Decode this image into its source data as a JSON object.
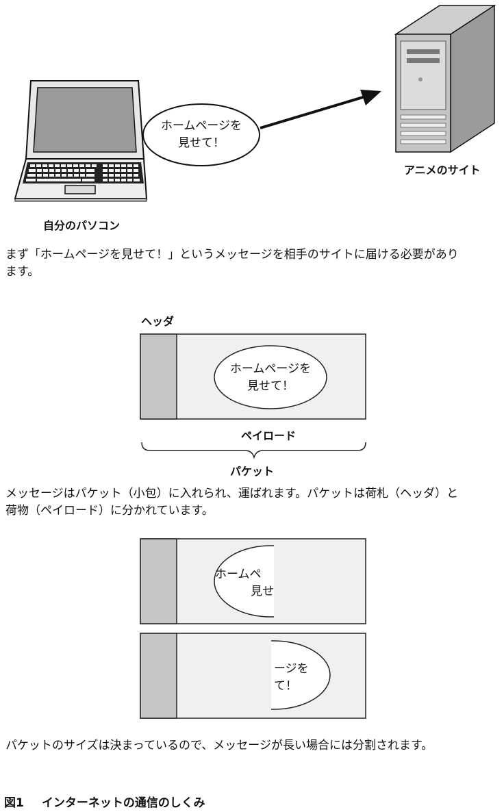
{
  "top_diagram": {
    "client_label": "自分のパソコン",
    "server_label": "アニメのサイト",
    "message_line1": "ホームページを",
    "message_line2": "見せて！"
  },
  "text1_line1": "まず「ホームページを見せて！」というメッセージを相手のサイトに届ける必要があり",
  "text1_line2": "ます。",
  "packet_diagram": {
    "header_label": "ヘッダ",
    "payload_label": "ペイロード",
    "packet_label": "パケット",
    "message_line1": "ホームページを",
    "message_line2": "見せて！"
  },
  "text2_line1": "メッセージはパケット（小包）に入れられ、運ばれます。パケットは荷札（ヘッダ）と",
  "text2_line2": "荷物（ペイロード）に分かれています。",
  "split_diagram": {
    "part1_line1": "ホームペ",
    "part1_line2": "見せ",
    "part2_line1": "ージを",
    "part2_line2": "て！"
  },
  "text3": "パケットのサイズは決まっているので、メッセージが長い場合には分割されます。",
  "caption": {
    "number": "図1",
    "title": "インターネットの通信のしくみ"
  },
  "colors": {
    "header_fill": "#c6c6c6",
    "packet_fill": "#f0f0f0",
    "stroke": "#222222"
  }
}
